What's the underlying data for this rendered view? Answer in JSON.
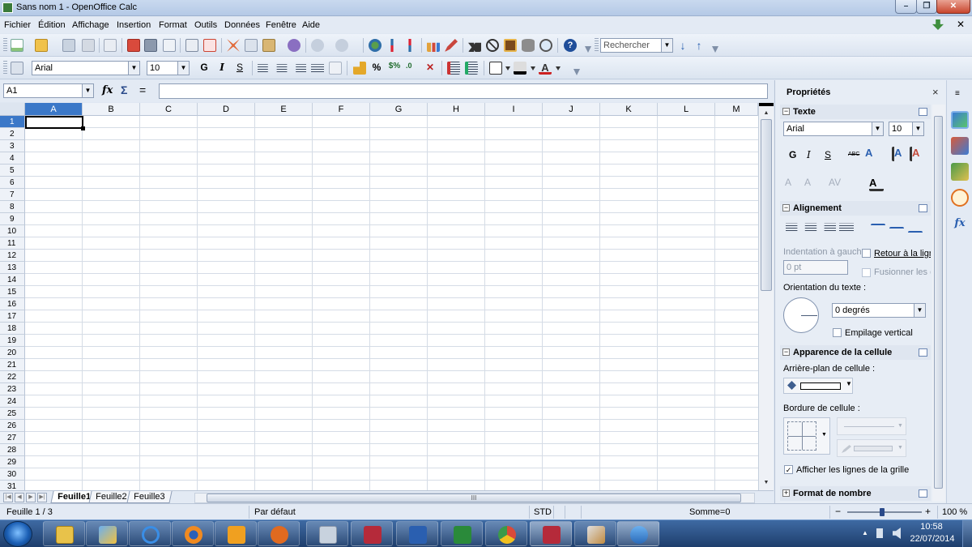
{
  "window": {
    "title": "Sans nom 1 - OpenOffice Calc",
    "min_label": "–",
    "max_label": "❐",
    "close_label": "✕"
  },
  "menu": [
    "Fichier",
    "Édition",
    "Affichage",
    "Insertion",
    "Format",
    "Outils",
    "Données",
    "Fenêtre",
    "Aide"
  ],
  "toolbar1": {
    "search_value": "Rechercher"
  },
  "toolbar2": {
    "font_name": "Arial",
    "font_size": "10",
    "bold": "G",
    "italic": "I",
    "underline": "S",
    "percent": "%",
    "currency": "$%"
  },
  "formula_bar": {
    "cell_ref": "A1",
    "fx": "fx",
    "sum": "Σ",
    "equals": "="
  },
  "grid": {
    "columns": [
      "A",
      "B",
      "C",
      "D",
      "E",
      "F",
      "G",
      "H",
      "I",
      "J",
      "K",
      "L",
      "M"
    ],
    "rows": [
      "1",
      "2",
      "3",
      "4",
      "5",
      "6",
      "7",
      "8",
      "9",
      "10",
      "11",
      "12",
      "13",
      "14",
      "15",
      "16",
      "17",
      "18",
      "19",
      "20",
      "21",
      "22",
      "23",
      "24",
      "25",
      "26",
      "27",
      "28",
      "29",
      "30",
      "31"
    ],
    "active_cell": "A1"
  },
  "sheets": [
    "Feuille1",
    "Feuille2",
    "Feuille3"
  ],
  "active_sheet": "Feuille1",
  "scroll_mid": "III",
  "sidebar": {
    "title": "Propriétés",
    "close": "×",
    "texte": {
      "header": "Texte",
      "font": "Arial",
      "size": "10",
      "bold": "G",
      "italic": "I",
      "underline": "S",
      "strike": "ABC"
    },
    "alignement": {
      "header": "Alignement",
      "indent_label": "Indentation à gauch",
      "indent_value": "0 pt",
      "wrap_label": "Retour à la ligr",
      "merge_label": "Fusionner les c",
      "orientation_label": "Orientation du texte :",
      "degrees_value": "0 degrés",
      "vertical_stack": "Empilage vertical"
    },
    "apparence": {
      "header": "Apparence de la cellule",
      "background_label": "Arrière-plan de cellule :",
      "border_label": "Bordure de cellule :",
      "gridlines_label": "Afficher les lignes de la grille",
      "gridlines_checked": true
    },
    "format_nombre": {
      "header": "Format de nombre"
    }
  },
  "status": {
    "sheet_info": "Feuille 1 / 3",
    "style": "Par défaut",
    "mode": "STD",
    "sum": "Somme=0",
    "zoom": "100 %",
    "zoom_minus": "−",
    "zoom_plus": "+"
  },
  "taskbar": {
    "time": "10:58",
    "date": "22/07/2014"
  },
  "colors": {
    "accent": "#3b78c8",
    "titlebar": "#c9d9ef",
    "taskbar": "#1e3e6c"
  }
}
